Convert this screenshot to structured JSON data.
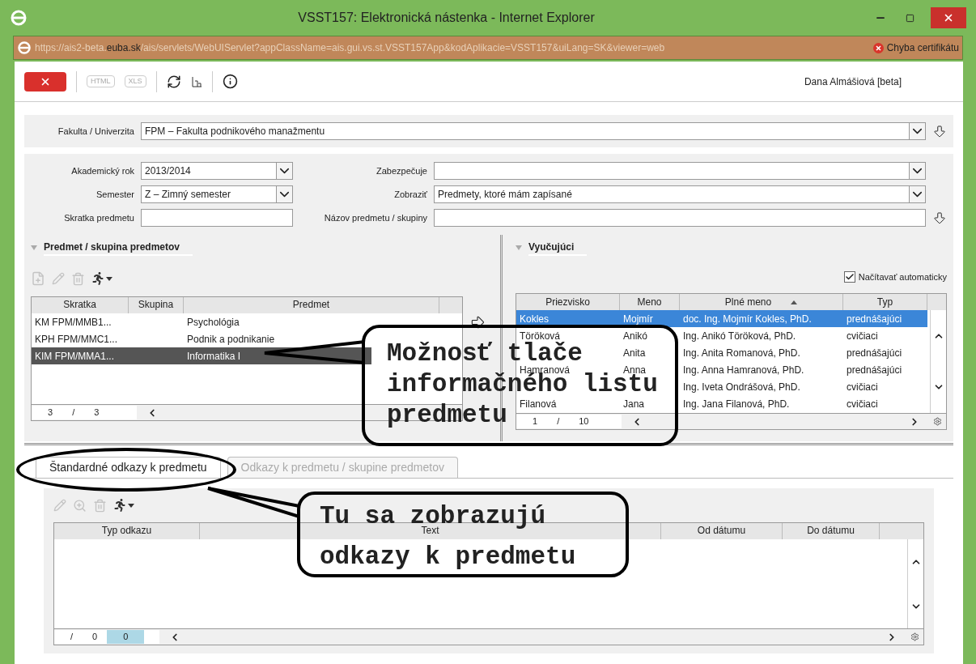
{
  "window": {
    "title": "VSST157: Elektronická nástenka - Internet Explorer"
  },
  "address_bar": {
    "url": "https://ais2-beta.**euba.sk**/ais/servlets/WebUIServlet?appClassName=ais.gui.vs.st.VSST157App&kodAplikacie=VSST157&uiLang=SK&viewer=web",
    "certificate_error": "Chyba certifikátu"
  },
  "toolbar": {
    "export_buttons": [
      {
        "label": "HTML",
        "disabled": true
      },
      {
        "label": "XLS",
        "disabled": true
      }
    ],
    "user": "Dana Almášiová [beta]"
  },
  "faculty": {
    "label": "Fakulta / Univerzita",
    "value": "FPM – Fakulta podnikového manažmentu"
  },
  "filters_left": [
    {
      "label": "Akademický rok",
      "value": "2013/2014",
      "kind": "select"
    },
    {
      "label": "Semester",
      "value": "Z – Zimný semester",
      "kind": "select"
    },
    {
      "label": "Skratka predmetu",
      "kind": "text"
    }
  ],
  "filters_right": [
    {
      "label": "Zabezpečuje",
      "kind": "select"
    },
    {
      "label": "Zobraziť",
      "value": "Predmety, ktoré mám zapísané",
      "kind": "select"
    },
    {
      "label": "Názov predmetu / skupiny",
      "kind": "text"
    }
  ],
  "subjects": {
    "title": "Predmet / skupina predmetov",
    "columns": [
      "Skratka",
      "Skupina",
      "Predmet"
    ],
    "rows": [
      {
        "cells": [
          "KM FPM/MMB1...",
          "",
          "Psychológia"
        ],
        "selected": false
      },
      {
        "cells": [
          "KPH FPM/MMC1...",
          "",
          "Podnik a podnikanie"
        ],
        "selected": false
      },
      {
        "cells": [
          "KIM FPM/MMA1...",
          "",
          "Informatika I"
        ],
        "selected": true
      }
    ],
    "pager": [
      "3",
      "/",
      "3"
    ]
  },
  "teachers": {
    "title": "Vyučujúci",
    "auto_load": {
      "label": "Načítavať automaticky",
      "checked": true
    },
    "columns": [
      {
        "label": "Priezvisko",
        "sorted": false
      },
      {
        "label": "Meno",
        "sorted": false
      },
      {
        "label": "Plné meno",
        "sorted": true
      },
      {
        "label": "Typ",
        "sorted": false
      }
    ],
    "rows": [
      {
        "cells": [
          "Kokles",
          "Mojmír",
          "doc. Ing. Mojmír Kokles, PhD.",
          "prednášajúci"
        ],
        "selected": true
      },
      {
        "cells": [
          "Töröková",
          "Anikó",
          "Ing. Anikó Töröková, PhD.",
          "cvičiaci"
        ],
        "selected": false
      },
      {
        "cells": [
          "",
          "Anita",
          "Ing. Anita Romanová, PhD.",
          "prednášajúci"
        ],
        "selected": false
      },
      {
        "cells": [
          "Hamranová",
          "Anna",
          "Ing. Anna Hamranová, PhD.",
          "prednášajúci"
        ],
        "selected": false
      },
      {
        "cells": [
          "",
          "",
          "Ing. Iveta Ondrášová, PhD.",
          "cvičiaci"
        ],
        "selected": false
      },
      {
        "cells": [
          "Filanová",
          "Jana",
          "Ing. Jana Filanová, PhD.",
          "cvičiaci"
        ],
        "selected": false
      }
    ],
    "pager": [
      "1",
      "/",
      "10"
    ]
  },
  "tabs": [
    {
      "label": "Štandardné odkazy k predmetu",
      "selected": true
    },
    {
      "label": "Odkazy k predmetu / skupine predmetov",
      "selected": false
    }
  ],
  "links_table": {
    "columns": [
      "Typ odkazu",
      "Text",
      "Od dátumu",
      "Do dátumu"
    ],
    "pager": [
      "/",
      "0",
      "0"
    ]
  },
  "callouts": [
    {
      "lines": [
        "Možnosť tlače",
        "informačného listu",
        "predmetu"
      ]
    },
    {
      "lines": [
        "Tu sa zobrazujú",
        "odkazy k predmetu"
      ]
    }
  ]
}
